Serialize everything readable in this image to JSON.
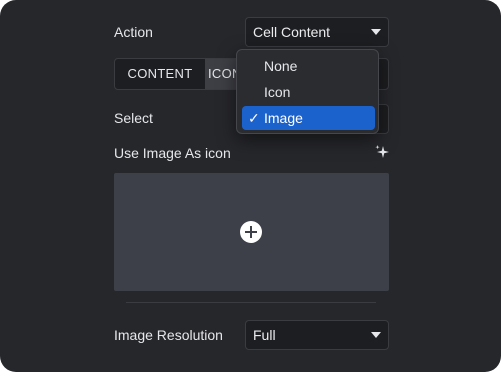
{
  "action": {
    "label": "Action",
    "value": "Cell Content",
    "options": [
      "None",
      "Icon",
      "Image"
    ],
    "selected": "Image",
    "check_glyph": "✓"
  },
  "tabs": {
    "content_label": "CONTENT",
    "icon_label": "ICON",
    "active": "ICON"
  },
  "select": {
    "label": "Select"
  },
  "image_icon": {
    "label": "Use Image As icon",
    "sparkle_icon": "ai-sparkle-icon",
    "add_icon": "plus-circle-icon"
  },
  "resolution": {
    "label": "Image Resolution",
    "value": "Full"
  },
  "colors": {
    "panel": "#26272b",
    "field": "#1d1e21",
    "drop_zone": "#3e4049",
    "selected_option": "#1c62cc",
    "active_tab": "#3d3f45"
  }
}
